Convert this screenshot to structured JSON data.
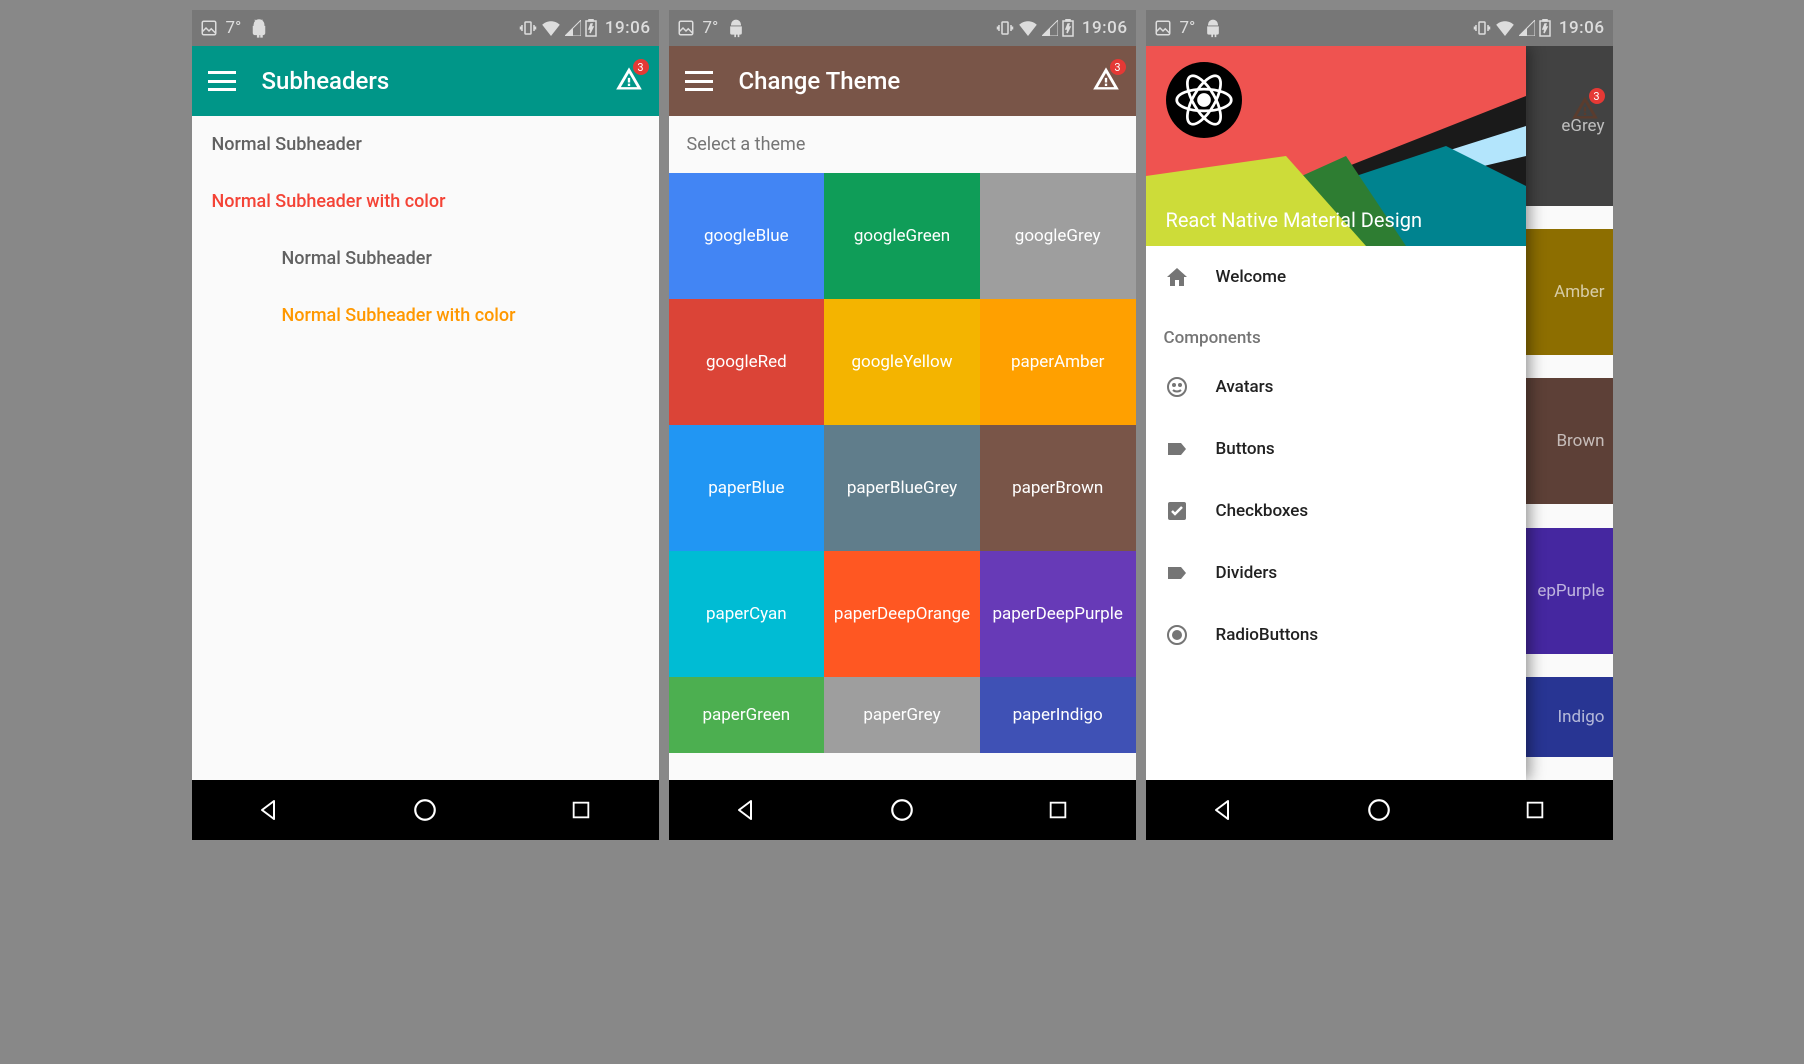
{
  "status": {
    "temp": "7°",
    "time": "19:06"
  },
  "badge_count": "3",
  "screen1": {
    "barColor": "#009688",
    "title": "Subheaders",
    "items": [
      {
        "text": "Normal Subheader",
        "cls": "sub-normal"
      },
      {
        "text": "Normal Subheader with color",
        "cls": "sub-red"
      },
      {
        "text": "Normal Subheader",
        "cls": "sub-normal sub-inset"
      },
      {
        "text": "Normal Subheader with color",
        "cls": "sub-orange sub-inset"
      }
    ]
  },
  "screen2": {
    "barColor": "#795548",
    "title": "Change Theme",
    "selectLabel": "Select a theme",
    "themes": [
      {
        "name": "googleBlue",
        "color": "#4285F4"
      },
      {
        "name": "googleGreen",
        "color": "#0F9D58"
      },
      {
        "name": "googleGrey",
        "color": "#9E9E9E"
      },
      {
        "name": "googleRed",
        "color": "#DB4437"
      },
      {
        "name": "googleYellow",
        "color": "#F4B400"
      },
      {
        "name": "paperAmber",
        "color": "#FFA000"
      },
      {
        "name": "paperBlue",
        "color": "#2196F3"
      },
      {
        "name": "paperBlueGrey",
        "color": "#607D8B"
      },
      {
        "name": "paperBrown",
        "color": "#795548"
      },
      {
        "name": "paperCyan",
        "color": "#00BCD4"
      },
      {
        "name": "paperDeepOrange",
        "color": "#FF5722"
      },
      {
        "name": "paperDeepPurple",
        "color": "#673AB7"
      },
      {
        "name": "paperGreen",
        "color": "#4CAF50"
      },
      {
        "name": "paperGrey",
        "color": "#9E9E9E"
      },
      {
        "name": "paperIndigo",
        "color": "#3F51B5"
      }
    ]
  },
  "screen3": {
    "headerTitle": "React Native Material Design",
    "bgThemes": [
      {
        "name": "",
        "color": "#424242"
      },
      {
        "name": "",
        "color": "#424242"
      },
      {
        "name": "eGrey",
        "color": "#424242"
      },
      {
        "name": "",
        "color": "#8d6e00"
      },
      {
        "name": "",
        "color": "#8d6e00"
      },
      {
        "name": "Amber",
        "color": "#8d6e00"
      },
      {
        "name": "",
        "color": "#5d4037"
      },
      {
        "name": "",
        "color": "#5d4037"
      },
      {
        "name": "Brown",
        "color": "#5d4037"
      },
      {
        "name": "",
        "color": "#4527a0"
      },
      {
        "name": "",
        "color": "#4527a0"
      },
      {
        "name": "epPurple",
        "color": "#4527a0"
      },
      {
        "name": "",
        "color": "#283593"
      },
      {
        "name": "",
        "color": "#283593"
      },
      {
        "name": "Indigo",
        "color": "#283593"
      }
    ],
    "welcome": "Welcome",
    "sectionLabel": "Components",
    "items": [
      {
        "icon": "face",
        "label": "Avatars"
      },
      {
        "icon": "label",
        "label": "Buttons"
      },
      {
        "icon": "checkbox",
        "label": "Checkboxes"
      },
      {
        "icon": "label",
        "label": "Dividers"
      },
      {
        "icon": "radio",
        "label": "RadioButtons"
      }
    ]
  }
}
